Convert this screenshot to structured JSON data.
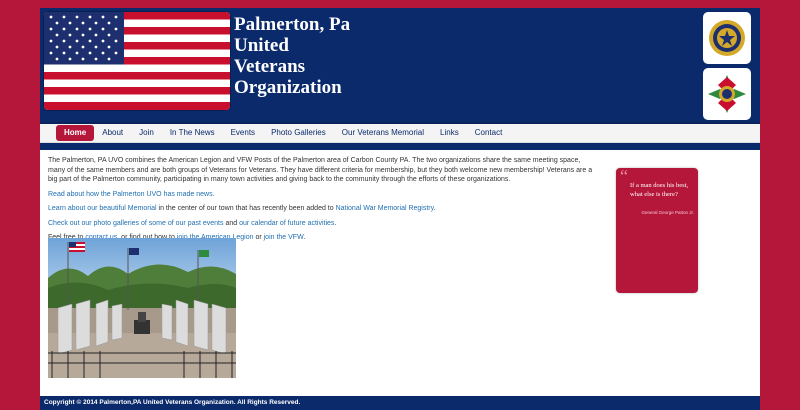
{
  "header": {
    "title_lines": [
      "Palmerton, Pa",
      "United",
      "Veterans",
      "Organization"
    ]
  },
  "nav": {
    "items": [
      "Home",
      "About",
      "Join",
      "In The News",
      "Events",
      "Photo Galleries",
      "Our Veterans Memorial",
      "Links",
      "Contact"
    ],
    "active": "Home"
  },
  "content": {
    "intro": "The Palmerton, PA  UVO combines the American Legion and VFW Posts of the Palmerton area of Carbon County PA. The two organizations share the same meeting space, many of the same members and are both groups of Veterans for Veterans. They have different criteria for membership, but they both welcome new membership! Veterans are a big part of the Palmerton community, participating in many town activities and giving back to the community through the efforts of these organizations.",
    "read_link": "Read about how the Palmerton UVO has made news.",
    "memorial_text_1": "Learn about our beautiful Memorial",
    "memorial_text_2": " in the center of our town that has recently been added to ",
    "memorial_link_2": "National War Memorial Registry",
    "memorial_text_3": ".",
    "photos_link": "Check out our photo galleries of some of our past events",
    "photos_and": " and ",
    "calendar_link": "our calendar of future activities",
    "calendar_end": ".",
    "free_text_1": "Feel free to ",
    "contact_link": "contact us",
    "free_text_2": ", or find out how to ",
    "legion_link": "join the American Legion",
    "free_text_3": " or ",
    "vfw_link": "join the VFW",
    "free_text_4": "."
  },
  "quote": {
    "mark": "“",
    "text": "If a man does his best, what else is there?",
    "author": "General George Patton Jr."
  },
  "footer": {
    "text": "Copyright © 2014 Palmerton,PA United Veterans Organization. All Rights Reserved."
  },
  "colors": {
    "navy": "#0b2a6b",
    "red": "#b5173a",
    "link": "#1f6fb2"
  },
  "icons": {
    "flag": "us-flag-icon",
    "legion": "american-legion-emblem-icon",
    "vfw": "vfw-emblem-icon"
  }
}
